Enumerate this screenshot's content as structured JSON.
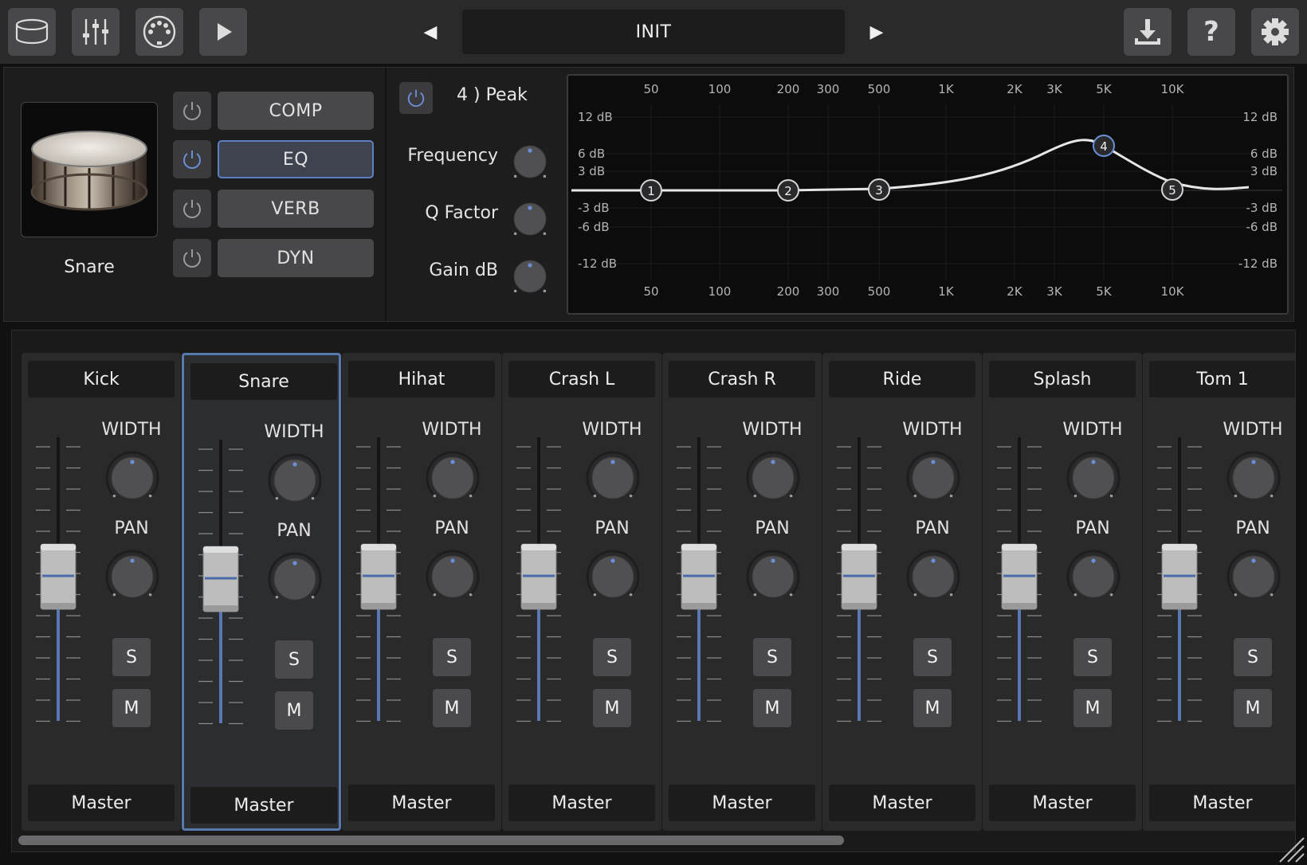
{
  "toolbar": {
    "icons": [
      "drum-kit-icon",
      "mixer-sliders-icon",
      "midi-port-icon",
      "play-icon",
      "download-icon",
      "help-icon",
      "gear-icon"
    ],
    "preset_name": "INIT",
    "prev": "◀",
    "next": "▶",
    "help": "?"
  },
  "instrument": {
    "name": "Snare"
  },
  "fx": [
    {
      "label": "COMP",
      "active": false
    },
    {
      "label": "EQ",
      "active": true
    },
    {
      "label": "VERB",
      "active": false
    },
    {
      "label": "DYN",
      "active": false
    }
  ],
  "eq": {
    "band_name": "4 ) Peak",
    "params": {
      "frequency": "Frequency",
      "q": "Q Factor",
      "gain": "Gain dB"
    },
    "freq_ticks": [
      "50",
      "100",
      "200",
      "300",
      "500",
      "1K",
      "2K",
      "3K",
      "5K",
      "10K"
    ],
    "db_ticks_left": [
      "12 dB",
      "6 dB",
      "3 dB",
      "-3 dB",
      "-6 dB",
      "-12 dB"
    ],
    "db_ticks_right": [
      "12 dB",
      "6 dB",
      "3 dB",
      "-3 dB",
      "-6 dB",
      "-12 dB"
    ],
    "nodes": [
      "1",
      "2",
      "3",
      "4",
      "5"
    ],
    "accent": "#6b8fd6"
  },
  "mixer": {
    "width_label": "WIDTH",
    "pan_label": "PAN",
    "solo_label": "S",
    "mute_label": "M",
    "channels": [
      {
        "name": "Kick",
        "route": "Master"
      },
      {
        "name": "Snare",
        "route": "Master",
        "selected": true
      },
      {
        "name": "Hihat",
        "route": "Master"
      },
      {
        "name": "Crash L",
        "route": "Master"
      },
      {
        "name": "Crash R",
        "route": "Master"
      },
      {
        "name": "Ride",
        "route": "Master"
      },
      {
        "name": "Splash",
        "route": "Master"
      },
      {
        "name": "Tom 1",
        "route": "Master"
      }
    ]
  }
}
